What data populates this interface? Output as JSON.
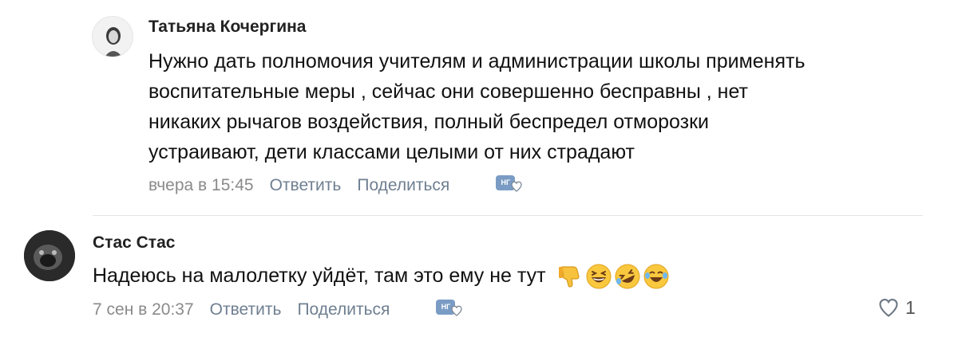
{
  "comments": [
    {
      "author": "Татьяна Кочергина",
      "text_lines": [
        "Нужно дать полномочия учителям и администрации школы применять",
        "воспитательные меры , сейчас они совершенно бесправны , нет",
        "никаких рычагов воздействия, полный беспредел отморозки",
        "устраивают, дети классами целыми от них страдают"
      ],
      "time": "вчера в 15:45",
      "reply_label": "Ответить",
      "share_label": "Поделиться",
      "reaction_badge": "НГ"
    },
    {
      "author": "Стас Стас",
      "text": "Надеюсь на малолетку уйдёт, там это ему не тут",
      "emojis": [
        "thumbs-down",
        "grinning-squinting",
        "rolling-laughing",
        "tears-of-joy"
      ],
      "time": "7 сен в 20:37",
      "reply_label": "Ответить",
      "share_label": "Поделиться",
      "reaction_badge": "НГ",
      "likes_count": "1"
    }
  ],
  "colors": {
    "action": "#6f7f91",
    "time": "#8a8a8a",
    "divider": "#e3e3e3"
  }
}
